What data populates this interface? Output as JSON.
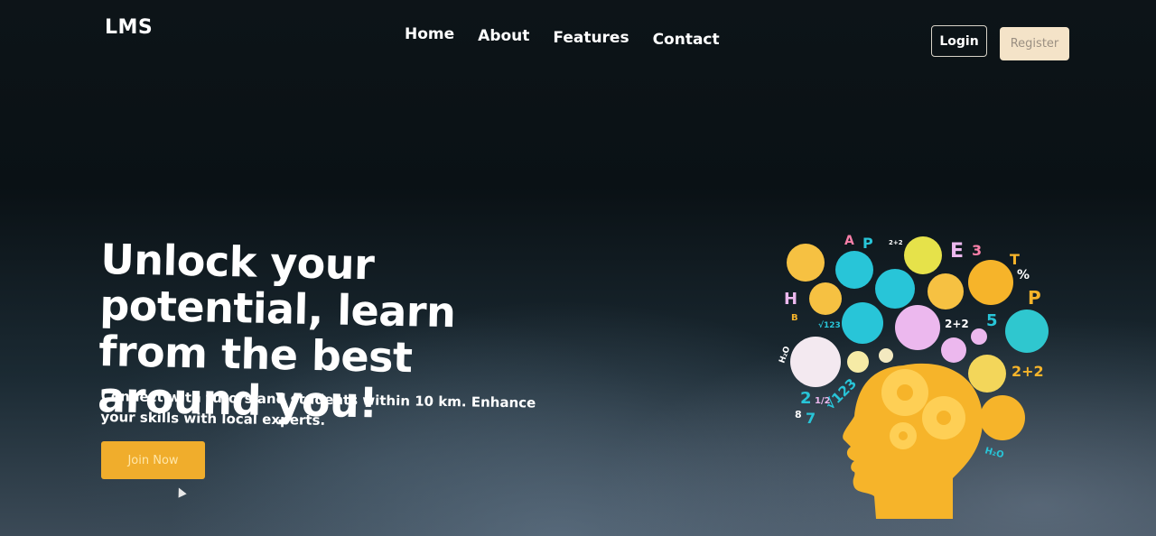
{
  "header": {
    "logo": "LMS",
    "nav": [
      "Home",
      "About",
      "Features",
      "Contact"
    ],
    "login_label": "Login",
    "register_label": "Register"
  },
  "hero": {
    "title": "Unlock your potential, learn from the best around you!",
    "subtitle": "Connect with tutors and students within 10 km. Enhance your skills with local experts.",
    "cta_label": "Join Now"
  },
  "illustration": {
    "icon": "learning-head-illustration-icon",
    "symbols": [
      "A",
      "P",
      "2+2",
      "E",
      "3",
      "T",
      "%",
      "P",
      "H",
      "B",
      "√123",
      "2+2",
      "5",
      "2+2",
      "H₂O",
      "2",
      "1/2",
      "8",
      "7",
      "√123",
      "H₂O"
    ]
  },
  "colors": {
    "accent": "#f0ad2c",
    "register_bg": "#f4e3c8",
    "head": "#f6b42a"
  }
}
